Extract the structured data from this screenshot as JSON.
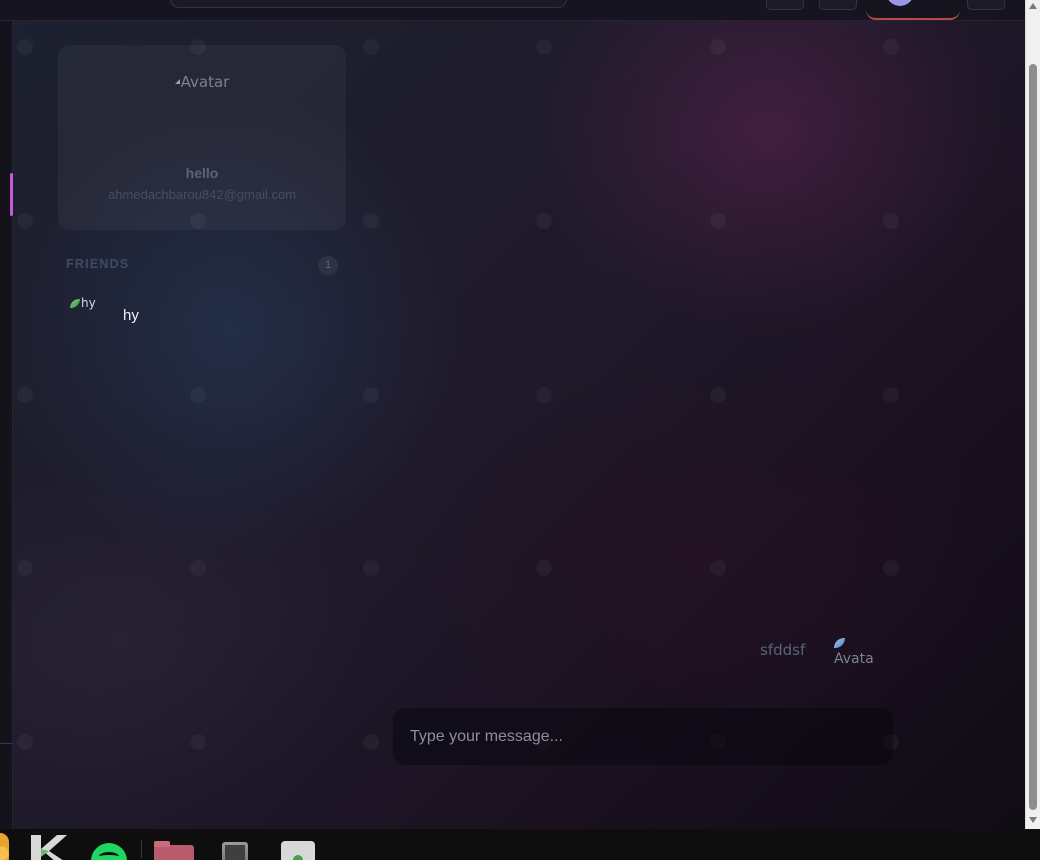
{
  "profile": {
    "avatar_alt": "Avatar",
    "name": "hello",
    "email": "ahmedachbarou842@gmail.com"
  },
  "friends": {
    "header": "FRIENDS",
    "count": "1",
    "items": [
      {
        "avatar_alt": "hy",
        "name": "hy"
      }
    ]
  },
  "chat": {
    "messages": [
      {
        "text": "sfddsf",
        "avatar_alt": "Avatar"
      }
    ],
    "composer_placeholder": "Type your message..."
  },
  "theme": {
    "accent": "#c45bd4",
    "profile_avatar": "#9b97e6",
    "profile_underline": "#b64a46"
  },
  "taskbar": {
    "apps": [
      "chrome-icon",
      "kotlin-icon",
      "spotify-icon",
      "files-icon",
      "phone-icon",
      "archive-icon"
    ]
  }
}
